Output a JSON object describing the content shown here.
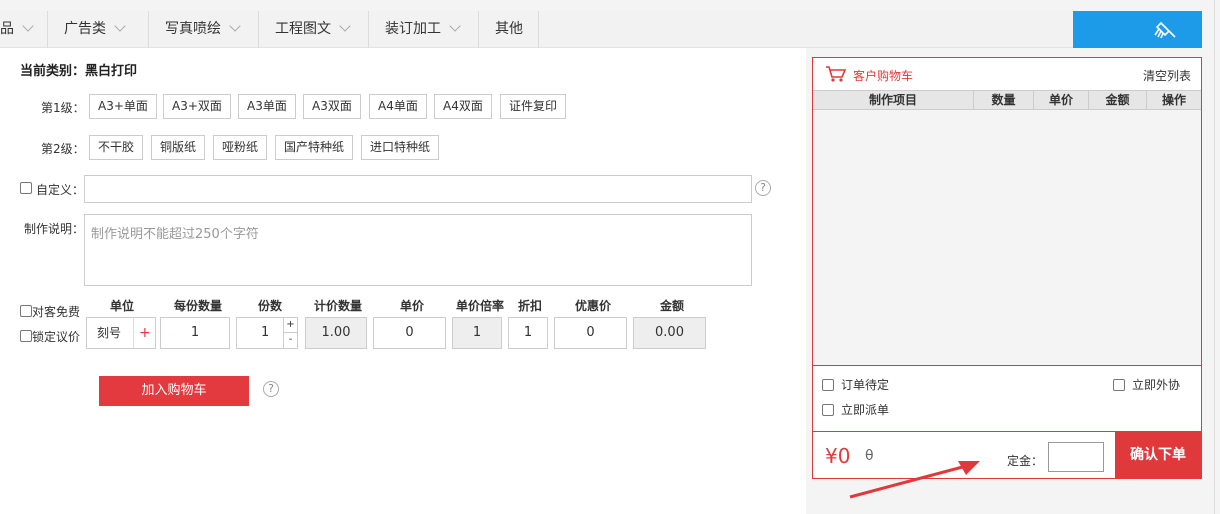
{
  "top_tabs": [
    {
      "label": "品"
    },
    {
      "label": "广告类"
    },
    {
      "label": "写真喷绘"
    },
    {
      "label": "工程图文"
    },
    {
      "label": "装订加工"
    },
    {
      "label": "其他"
    }
  ],
  "current_category": "当前类别：黑白打印",
  "level1": {
    "label": "第1级：",
    "options": [
      "A3+单面",
      "A3+双面",
      "A3单面",
      "A3双面",
      "A4单面",
      "A4双面",
      "证件复印"
    ]
  },
  "level2": {
    "label": "第2级：",
    "options": [
      "不干胶",
      "铜版纸",
      "哑粉纸",
      "国产特种纸",
      "进口特种纸"
    ]
  },
  "custom": {
    "label": "自定义："
  },
  "notes": {
    "label": "制作说明：",
    "placeholder": "制作说明不能超过250个字符"
  },
  "checks": {
    "free": "对客免费",
    "lock_price": "锁定议价"
  },
  "headers": {
    "unit": "单位",
    "per_qty": "每份数量",
    "copies": "份数",
    "priced_qty": "计价数量",
    "unit_price": "单价",
    "price_ratio": "单价倍率",
    "discount": "折扣",
    "special_price": "优惠价",
    "amount": "金额"
  },
  "values": {
    "unit": "刻号",
    "per_qty": "1",
    "copies": "1",
    "priced_qty": "1.00",
    "unit_price": "0",
    "price_ratio": "1",
    "discount": "1",
    "special_price": "0",
    "amount": "0.00"
  },
  "add_to_cart": "加入购物车",
  "cart": {
    "title": "客户购物车",
    "clear": "清空列表",
    "columns": [
      "制作项目",
      "数量",
      "单价",
      "金额",
      "操作"
    ],
    "pending": "订单待定",
    "dispatch": "立即派单",
    "outsource": "立即外协",
    "total": "¥0",
    "theta": "θ",
    "deposit_label": "定金：",
    "confirm": "确认下单"
  },
  "colors": {
    "accent": "#e0393c",
    "blue": "#1e9be8"
  }
}
